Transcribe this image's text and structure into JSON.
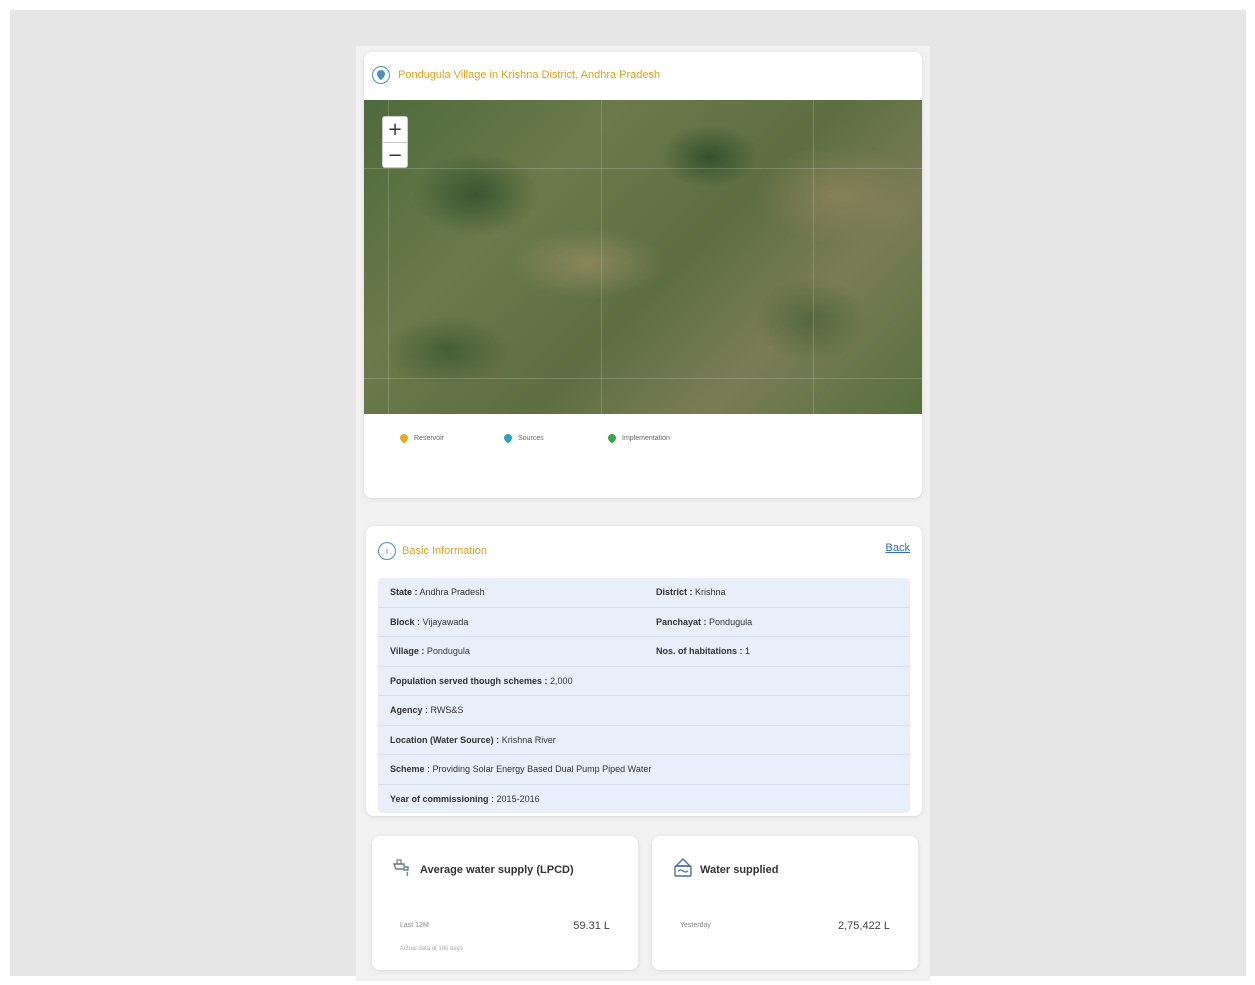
{
  "map_card": {
    "title": "Pondugula Village in Krishna District, Andhra Pradesh",
    "zoom_in": "+",
    "zoom_out": "−",
    "legend": [
      {
        "label": "Reservoir",
        "color": "#e8a822"
      },
      {
        "label": "Sources",
        "color": "#2aa0c8"
      },
      {
        "label": "Implementation",
        "color": "#3aa64a"
      }
    ]
  },
  "info_card": {
    "title": "Basic Information",
    "back_label": "Back",
    "rows": [
      {
        "left": {
          "label": "State :",
          "value": "Andhra Pradesh"
        },
        "right": {
          "label": "District :",
          "value": "Krishna"
        }
      },
      {
        "left": {
          "label": "Block :",
          "value": "Vijayawada"
        },
        "right": {
          "label": "Panchayat :",
          "value": "Pondugula"
        }
      },
      {
        "left": {
          "label": "Village :",
          "value": "Pondugula"
        },
        "right": {
          "label": "Nos. of habitations :",
          "value": "1"
        }
      },
      {
        "full": {
          "label": "Population served though schemes :",
          "value": "2,000"
        }
      },
      {
        "full": {
          "label": "Agency :",
          "value": "RWS&S"
        }
      },
      {
        "full": {
          "label": "Location (Water Source) :",
          "value": "Krishna River"
        }
      },
      {
        "full": {
          "label": "Scheme :",
          "value": "Providing Solar Energy Based Dual Pump Piped Water"
        }
      },
      {
        "full": {
          "label": "Year of commissioning :",
          "value": "2015-2016"
        }
      }
    ]
  },
  "stats": [
    {
      "title": "Average water supply (LPCD)",
      "sub": "Last 12M",
      "note": "Actual data of 180 days",
      "value": "59.31 L",
      "icon": "tap-icon"
    },
    {
      "title": "Water supplied",
      "sub": "Yesterday",
      "note": "",
      "value": "2,75,422 L",
      "icon": "tank-icon"
    }
  ],
  "colors": {
    "accent": "#e0a21a",
    "link": "#2d6fb8",
    "table_bg": "#e9effa"
  }
}
